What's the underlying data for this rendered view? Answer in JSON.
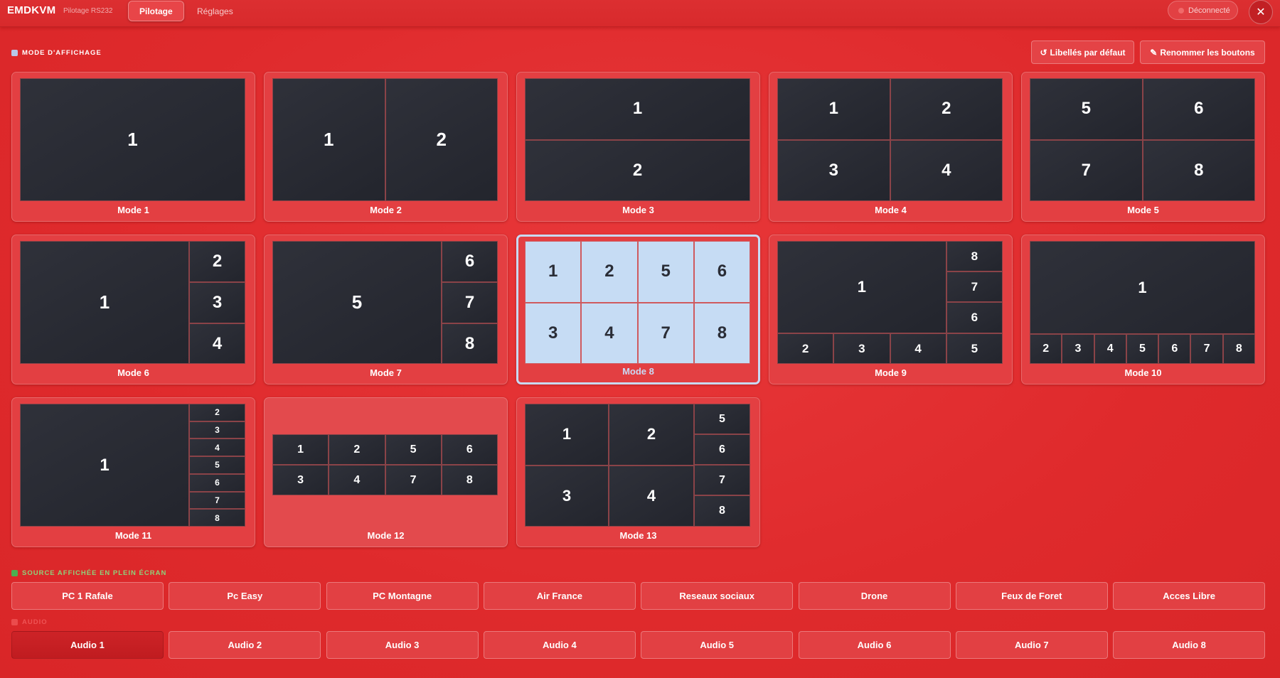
{
  "app": {
    "brand": "EMDKVM",
    "subtitle": "Pilotage RS232"
  },
  "tabs": [
    {
      "label": "Pilotage",
      "active": true
    },
    {
      "label": "Réglages",
      "active": false
    }
  ],
  "connection": {
    "status": "Déconnecté",
    "close_glyph": "✕"
  },
  "display_mode": {
    "section_title": "MODE D'AFFICHAGE",
    "reset_label": "Libellés par défaut",
    "rename_label": "Renommer les boutons",
    "selected": "Mode 8",
    "modes": [
      {
        "title": "Mode 1",
        "cells": [
          "1"
        ]
      },
      {
        "title": "Mode 2",
        "cells": [
          "1",
          "2"
        ]
      },
      {
        "title": "Mode 3",
        "cells": [
          "1",
          "2"
        ]
      },
      {
        "title": "Mode 4",
        "cells": [
          "1",
          "2",
          "3",
          "4"
        ]
      },
      {
        "title": "Mode 5",
        "cells": [
          "5",
          "6",
          "7",
          "8"
        ]
      },
      {
        "title": "Mode 6",
        "cells": [
          "1",
          "2",
          "3",
          "4"
        ]
      },
      {
        "title": "Mode 7",
        "cells": [
          "5",
          "6",
          "7",
          "8"
        ]
      },
      {
        "title": "Mode 8",
        "cells": [
          "1",
          "2",
          "5",
          "6",
          "3",
          "4",
          "7",
          "8"
        ]
      },
      {
        "title": "Mode 9",
        "cells": [
          "1",
          "8",
          "7",
          "6",
          "2",
          "3",
          "4",
          "5"
        ]
      },
      {
        "title": "Mode 10",
        "cells": [
          "1",
          "2",
          "3",
          "4",
          "5",
          "6",
          "7",
          "8"
        ]
      },
      {
        "title": "Mode 11",
        "cells": [
          "1",
          "2",
          "3",
          "4",
          "5",
          "6",
          "7",
          "8"
        ]
      },
      {
        "title": "Mode 12",
        "cells": [
          "1",
          "2",
          "5",
          "6",
          "3",
          "4",
          "7",
          "8"
        ]
      },
      {
        "title": "Mode 13",
        "cells": [
          "1",
          "2",
          "5",
          "6",
          "3",
          "4",
          "7",
          "8"
        ]
      }
    ]
  },
  "fullscreen_source": {
    "section_title": "SOURCE AFFICHÉE EN PLEIN ÉCRAN",
    "items": [
      "PC 1 Rafale",
      "Pc Easy",
      "PC Montagne",
      "Air France",
      "Reseaux sociaux",
      "Drone",
      "Feux de Foret",
      "Acces Libre"
    ]
  },
  "audio": {
    "section_title": "AUDIO",
    "active": "Audio 1",
    "items": [
      "Audio 1",
      "Audio 2",
      "Audio 3",
      "Audio 4",
      "Audio 5",
      "Audio 6",
      "Audio 7",
      "Audio 8"
    ]
  },
  "colors": {
    "background": "#df2a2c",
    "card": "#e33f42",
    "screen": "#2a2c34",
    "selected_accent": "#c9daf5",
    "green_marker": "#4caf50"
  },
  "icons": {
    "reset": "refresh-icon",
    "rename": "pencil-icon",
    "close": "close-icon",
    "status": "status-dot-icon"
  }
}
